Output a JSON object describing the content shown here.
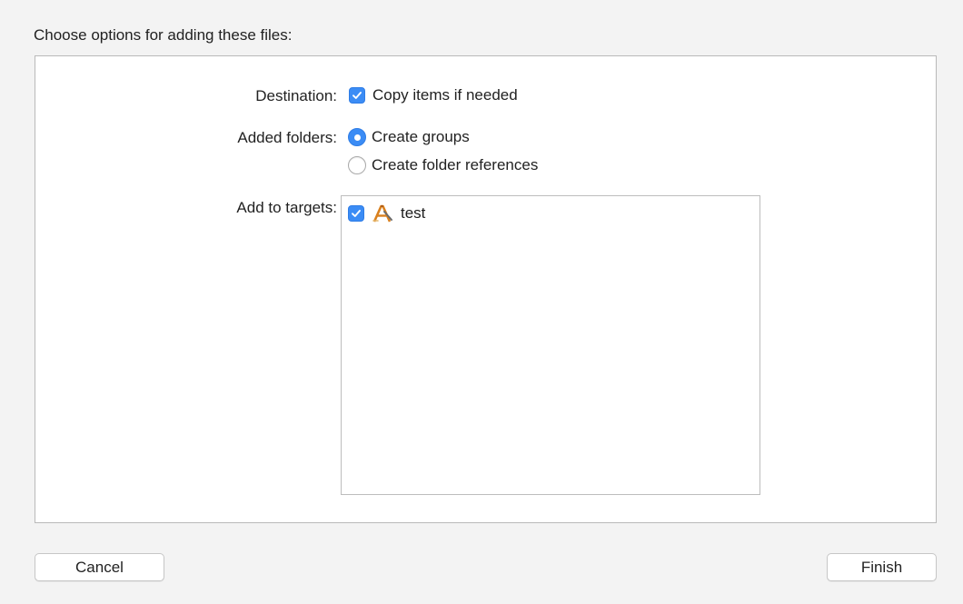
{
  "dialog": {
    "heading": "Choose options for adding these files:"
  },
  "options": {
    "destination": {
      "label": "Destination:",
      "checkbox_label": "Copy items if needed",
      "checked": true
    },
    "added_folders": {
      "label": "Added folders:",
      "choices": [
        {
          "label": "Create groups",
          "selected": true
        },
        {
          "label": "Create folder references",
          "selected": false
        }
      ]
    },
    "add_to_targets": {
      "label": "Add to targets:",
      "targets": [
        {
          "name": "test",
          "checked": true,
          "icon": "xcode-app-icon"
        }
      ]
    }
  },
  "footer": {
    "cancel_label": "Cancel",
    "finish_label": "Finish"
  },
  "colors": {
    "accent": "#3b8cf5",
    "panel_background": "#ffffff",
    "window_background": "#f3f3f3"
  }
}
